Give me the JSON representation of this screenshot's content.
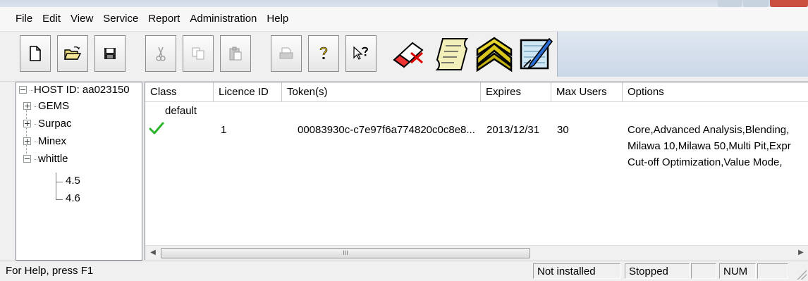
{
  "menu": [
    "File",
    "Edit",
    "View",
    "Service",
    "Report",
    "Administration",
    "Help"
  ],
  "toolbar": {
    "icons": [
      "new-icon",
      "open-icon",
      "save-icon",
      "cut-icon",
      "copy-icon",
      "paste-icon",
      "print-icon",
      "about-icon",
      "context-help-icon",
      "eraser-icon",
      "scroll-icon",
      "chevron-rank-icon",
      "edit-licence-icon"
    ]
  },
  "tree": {
    "root": "HOST ID: aa023150",
    "nodes": [
      "GEMS",
      "Surpac",
      "Minex",
      "whittle"
    ],
    "whittle_children": [
      "4.5",
      "4.6"
    ]
  },
  "table": {
    "columns": [
      "Class",
      "Licence ID",
      "Token(s)",
      "Expires",
      "Max Users",
      "Options"
    ],
    "group": "default",
    "row": {
      "licence_id": "1",
      "token": "00083930c-c7e97f6a774820c0c8e8...",
      "expires": "2013/12/31",
      "max_users": "30",
      "options": [
        "Core,Advanced Analysis,Blending,",
        "Milawa 10,Milawa 50,Multi Pit,Expr",
        "Cut-off Optimization,Value Mode,"
      ]
    }
  },
  "scrollbar": {
    "thumb_glyph": "III"
  },
  "status": {
    "help": "For Help, press F1",
    "install_state": "Not installed",
    "service_state": "Stopped",
    "num": "NUM"
  },
  "colors": {
    "check": "#2db52d",
    "selection": "#ffffff"
  }
}
